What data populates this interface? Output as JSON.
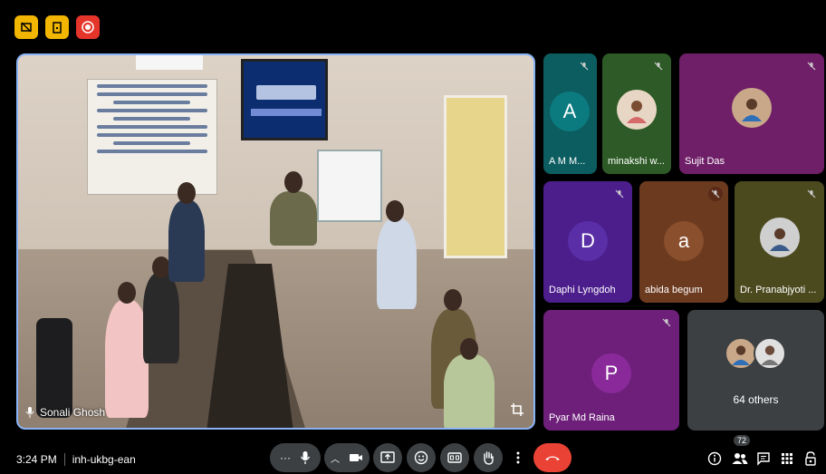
{
  "main_speaker": {
    "name": "Sonali Ghosh"
  },
  "tiles": [
    {
      "initial": "A",
      "name": "A M M...",
      "bg": "#0c5d5f",
      "avatar_bg": "#0b7b80"
    },
    {
      "initial": "",
      "name": "minakshi w...",
      "bg": "#2d5a26",
      "avatar_bg": "#e8d6c4"
    },
    {
      "initial": "",
      "name": "Sujit Das",
      "bg": "#6f1f67",
      "avatar_bg": "#c9a88a"
    },
    {
      "initial": "D",
      "name": "Daphi Lyngdoh",
      "bg": "#4c1e8c",
      "avatar_bg": "#5a2ea6"
    },
    {
      "initial": "a",
      "name": "abida begum",
      "bg": "#6c3a1f",
      "avatar_bg": "#8a4f2c"
    },
    {
      "initial": "",
      "name": "Dr. Pranabjyoti ...",
      "bg": "#4b4a1f",
      "avatar_bg": "#cfcfcf"
    },
    {
      "initial": "P",
      "name": "Pyar Md Raina",
      "bg": "#6d1f7a",
      "avatar_bg": "#8a2a9a"
    }
  ],
  "others": {
    "label": "64 others"
  },
  "meeting": {
    "time": "3:24 PM",
    "code": "inh-ukbg-ean"
  },
  "participants_count": "72",
  "colors": {
    "accent": "#8ab4f8",
    "end_call": "#ea4335",
    "control_bg": "#3c4043"
  }
}
